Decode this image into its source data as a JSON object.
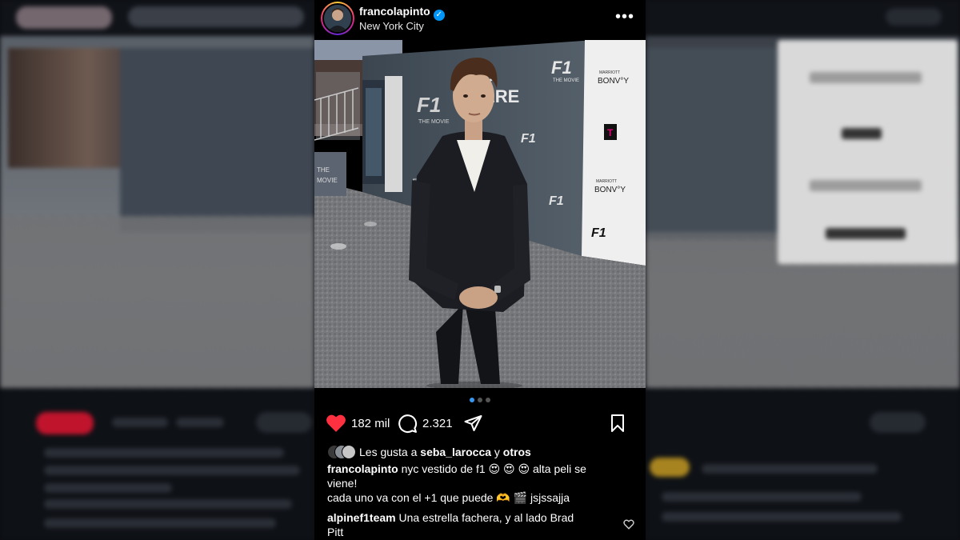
{
  "post": {
    "username": "francolapinto",
    "location": "New York City",
    "verified": true,
    "actions": {
      "likes_count": "182 mil",
      "comments_count": "2.321"
    },
    "liked_by": {
      "prefix": "Les gusta a",
      "user": "seba_larocca",
      "connector": "y",
      "others": "otros"
    },
    "caption": {
      "user": "francolapinto",
      "line1_text": "nyc vestido de f1",
      "line1_emojis": "😍 😍 😍",
      "line1_tail": "alta peli se",
      "line2": "viene!",
      "line3_text": "cada uno va con el +1 que puede",
      "line3_emojis": "🫶 🎬",
      "line3_tail": "jsjssajja"
    },
    "comment": {
      "user": "alpinef1team",
      "text_line1": "Una estrella fachera, y al lado Brad",
      "text_line2": "Pitt"
    },
    "carousel": {
      "total": 3,
      "active": 1
    },
    "photo_signage": {
      "f1_text": "F1",
      "the_movie": "THE MOVIE",
      "sponsor_small": "MARRIOTT",
      "sponsor": "BONVOY",
      "premiere_partial": "D\nIERE",
      "t_logo": "T"
    }
  },
  "icons": [
    "more-icon",
    "heart-icon",
    "comment-icon",
    "share-icon",
    "bookmark-icon",
    "verified-icon",
    "small-heart-icon"
  ],
  "colors": {
    "heart": "#ff3040",
    "verified": "#0095f6",
    "carousel_active": "#3897f0"
  }
}
